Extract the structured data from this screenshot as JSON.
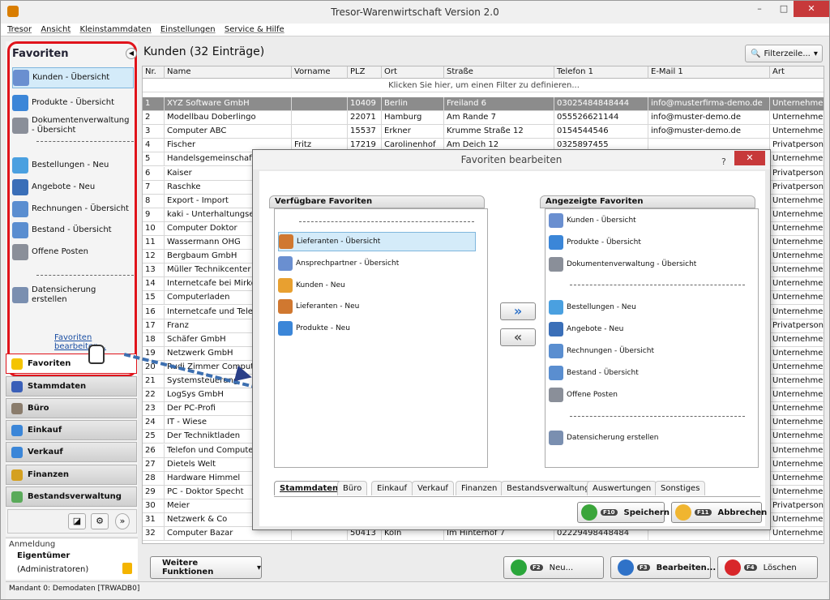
{
  "app": {
    "title": "Tresor-Warenwirtschaft Version 2.0"
  },
  "menu": [
    "Tresor",
    "Ansicht",
    "Kleinstammdaten",
    "Einstellungen",
    "Service & Hilfe"
  ],
  "favoriten": {
    "header": "Favoriten",
    "items": [
      {
        "label": "Kunden - Übersicht",
        "icon": "customer-icon",
        "color": "#6a8fd0"
      },
      {
        "label": "Produkte - Übersicht",
        "icon": "product-icon",
        "color": "#3b86d8"
      },
      {
        "label": "Dokumentenverwaltung - Übersicht",
        "icon": "document-icon",
        "color": "#8a8f99"
      },
      {
        "label": "Bestellungen - Neu",
        "icon": "order-icon",
        "color": "#4aa0e0"
      },
      {
        "label": "Angebote - Neu",
        "icon": "offer-icon",
        "color": "#3a6fb8"
      },
      {
        "label": "Rechnungen - Übersicht",
        "icon": "invoice-icon",
        "color": "#5a8ed0"
      },
      {
        "label": "Bestand - Übersicht",
        "icon": "stock-icon",
        "color": "#5a8ed0"
      },
      {
        "label": "Offene Posten",
        "icon": "open-items-icon",
        "color": "#8a8f99"
      },
      {
        "label": "Datensicherung erstellen",
        "icon": "backup-icon",
        "color": "#7a8fb0"
      }
    ],
    "edit_link": "Favoriten bearbeiten..."
  },
  "nav": [
    {
      "label": "Favoriten",
      "icon": "star-icon"
    },
    {
      "label": "Stammdaten",
      "icon": "book-icon"
    },
    {
      "label": "Büro",
      "icon": "office-icon"
    },
    {
      "label": "Einkauf",
      "icon": "purchase-icon"
    },
    {
      "label": "Verkauf",
      "icon": "sales-icon"
    },
    {
      "label": "Finanzen",
      "icon": "finance-icon"
    },
    {
      "label": "Bestandsverwaltung",
      "icon": "inventory-icon"
    }
  ],
  "anmeldung": {
    "label": "Anmeldung",
    "user": "Eigentümer",
    "role": "(Administratoren)"
  },
  "status": "Mandant 0: Demodaten [TRWADB0]",
  "main": {
    "title": "Kunden (32 Einträge)",
    "filter_button": "Filterzeile...",
    "filter_hint": "Klicken Sie hier, um einen Filter zu definieren..."
  },
  "table": {
    "columns": [
      "Nr.",
      "Name",
      "Vorname",
      "PLZ",
      "Ort",
      "Straße",
      "Telefon 1",
      "E-Mail 1",
      "Art"
    ],
    "rows": [
      [
        "1",
        "XYZ Software GmbH",
        "",
        "10409",
        "Berlin",
        "Freiland 6",
        "03025484848444",
        "info@musterfirma-demo.de",
        "Unternehmen"
      ],
      [
        "2",
        "Modellbau Doberlingo",
        "",
        "22071",
        "Hamburg",
        "Am Rande 7",
        "055526621144",
        "info@muster-demo.de",
        "Unternehmen"
      ],
      [
        "3",
        "Computer ABC",
        "",
        "15537",
        "Erkner",
        "Krumme Straße 12",
        "0154544546",
        "info@muster-demo.de",
        "Unternehmen"
      ],
      [
        "4",
        "Fischer",
        "Fritz",
        "17219",
        "Carolinenhof",
        "Am Deich 12",
        "0325897455",
        "",
        "Privatperson"
      ],
      [
        "5",
        "Handelsgemeinschaft",
        "",
        "",
        "",
        "",
        "",
        "",
        "Unternehmen"
      ],
      [
        "6",
        "Kaiser",
        "",
        "",
        "",
        "",
        "",
        "",
        "Privatperson"
      ],
      [
        "7",
        "Raschke",
        "",
        "",
        "",
        "",
        "",
        "",
        "Privatperson"
      ],
      [
        "8",
        "Export - Import",
        "",
        "",
        "",
        "",
        "",
        "",
        "Unternehmen"
      ],
      [
        "9",
        "kaki - Unterhaltungsel",
        "",
        "",
        "",
        "",
        "",
        "",
        "Unternehmen"
      ],
      [
        "10",
        "Computer Doktor",
        "",
        "",
        "",
        "",
        "",
        "",
        "Unternehmen"
      ],
      [
        "11",
        "Wassermann OHG",
        "",
        "",
        "",
        "",
        "",
        "",
        "Unternehmen"
      ],
      [
        "12",
        "Bergbaum GmbH",
        "",
        "",
        "",
        "",
        "",
        "",
        "Unternehmen"
      ],
      [
        "13",
        "Müller Technikcenter",
        "",
        "",
        "",
        "",
        "",
        "",
        "Unternehmen"
      ],
      [
        "14",
        "Internetcafe bei Mirko",
        "",
        "",
        "",
        "",
        "",
        "",
        "Unternehmen"
      ],
      [
        "15",
        "Computerladen",
        "",
        "",
        "",
        "",
        "",
        "",
        "Unternehmen"
      ],
      [
        "16",
        "Internetcafe und Telefo",
        "",
        "",
        "",
        "",
        "",
        "",
        "Unternehmen"
      ],
      [
        "17",
        "Franz",
        "",
        "",
        "",
        "",
        "",
        "",
        "Privatperson"
      ],
      [
        "18",
        "Schäfer GmbH",
        "",
        "",
        "",
        "",
        "",
        "",
        "Unternehmen"
      ],
      [
        "19",
        "Netzwerk GmbH",
        "",
        "",
        "",
        "",
        "",
        "",
        "Unternehmen"
      ],
      [
        "20",
        "Rudi Zimmer Computer",
        "",
        "",
        "",
        "",
        "",
        "",
        "Unternehmen"
      ],
      [
        "21",
        "Systemsteuerung",
        "",
        "",
        "",
        "",
        "",
        "",
        "Unternehmen"
      ],
      [
        "22",
        "LogSys GmbH",
        "",
        "",
        "",
        "",
        "",
        "",
        "Unternehmen"
      ],
      [
        "23",
        "Der PC-Profi",
        "",
        "",
        "",
        "",
        "",
        "",
        "Unternehmen"
      ],
      [
        "24",
        "IT - Wiese",
        "",
        "",
        "",
        "",
        "",
        "",
        "Unternehmen"
      ],
      [
        "25",
        "Der Techniktladen",
        "",
        "",
        "",
        "",
        "",
        "",
        "Unternehmen"
      ],
      [
        "26",
        "Telefon und Computer",
        "",
        "",
        "",
        "",
        "",
        "",
        "Unternehmen"
      ],
      [
        "27",
        "Dietels Welt",
        "",
        "",
        "",
        "",
        "",
        "",
        "Unternehmen"
      ],
      [
        "28",
        "Hardware Himmel",
        "",
        "",
        "",
        "",
        "",
        "",
        "Unternehmen"
      ],
      [
        "29",
        "PC - Doktor Specht",
        "",
        "",
        "",
        "",
        "",
        "",
        "Unternehmen"
      ],
      [
        "30",
        "Meier",
        "",
        "",
        "",
        "",
        "",
        "",
        "Privatperson"
      ],
      [
        "31",
        "Netzwerk & Co",
        "",
        "",
        "",
        "",
        "",
        "",
        "Unternehmen"
      ],
      [
        "32",
        "Computer Bazar",
        "",
        "50413",
        "Köln",
        "Im Hinterhof 7",
        "02229498448484",
        "",
        "Unternehmen"
      ]
    ]
  },
  "bottom": {
    "weitere": "Weitere Funktionen",
    "neu": "Neu...",
    "bearbeiten": "Bearbeiten...",
    "loeschen": "Löschen",
    "f2": "F2",
    "f3": "F3",
    "f4": "F4"
  },
  "dialog": {
    "title": "Favoriten bearbeiten",
    "help": "?",
    "close": "✕",
    "available_header": "Verfügbare Favoriten",
    "shown_header": "Angezeigte Favoriten",
    "available": [
      {
        "label": "Lieferanten - Übersicht",
        "icon": "supplier-icon",
        "color": "#d07830"
      },
      {
        "label": "Ansprechpartner - Übersicht",
        "icon": "contact-icon",
        "color": "#6a8fd0"
      },
      {
        "label": "Kunden - Neu",
        "icon": "customer-new-icon",
        "color": "#e8a030"
      },
      {
        "label": "Lieferanten - Neu",
        "icon": "supplier-new-icon",
        "color": "#d07830"
      },
      {
        "label": "Produkte - Neu",
        "icon": "product-new-icon",
        "color": "#3b86d8"
      }
    ],
    "shown": [
      {
        "label": "Kunden - Übersicht",
        "icon": "customer-icon",
        "color": "#6a8fd0"
      },
      {
        "label": "Produkte - Übersicht",
        "icon": "product-icon",
        "color": "#3b86d8"
      },
      {
        "label": "Dokumentenverwaltung - Übersicht",
        "icon": "document-icon",
        "color": "#8a8f99"
      },
      {
        "label": "Bestellungen - Neu",
        "icon": "order-icon",
        "color": "#4aa0e0"
      },
      {
        "label": "Angebote - Neu",
        "icon": "offer-icon",
        "color": "#3a6fb8"
      },
      {
        "label": "Rechnungen - Übersicht",
        "icon": "invoice-icon",
        "color": "#5a8ed0"
      },
      {
        "label": "Bestand - Übersicht",
        "icon": "stock-icon",
        "color": "#5a8ed0"
      },
      {
        "label": "Offene Posten",
        "icon": "open-items-icon",
        "color": "#8a8f99"
      },
      {
        "label": "Datensicherung erstellen",
        "icon": "backup-icon",
        "color": "#7a8fb0"
      }
    ],
    "add": "»",
    "remove": "«",
    "tabs": [
      "Stammdaten",
      "Büro",
      "Einkauf",
      "Verkauf",
      "Finanzen",
      "Bestandsverwaltung",
      "Auswertungen",
      "Sonstiges"
    ],
    "save": "Speichern",
    "cancel": "Abbrechen",
    "f10": "F10",
    "f11": "F11"
  },
  "colors": {
    "accent_red": "#e0131b",
    "selected_row": "#8c8c8c",
    "selection_blue": "#d4ebf9",
    "close_red": "#c7393a"
  }
}
